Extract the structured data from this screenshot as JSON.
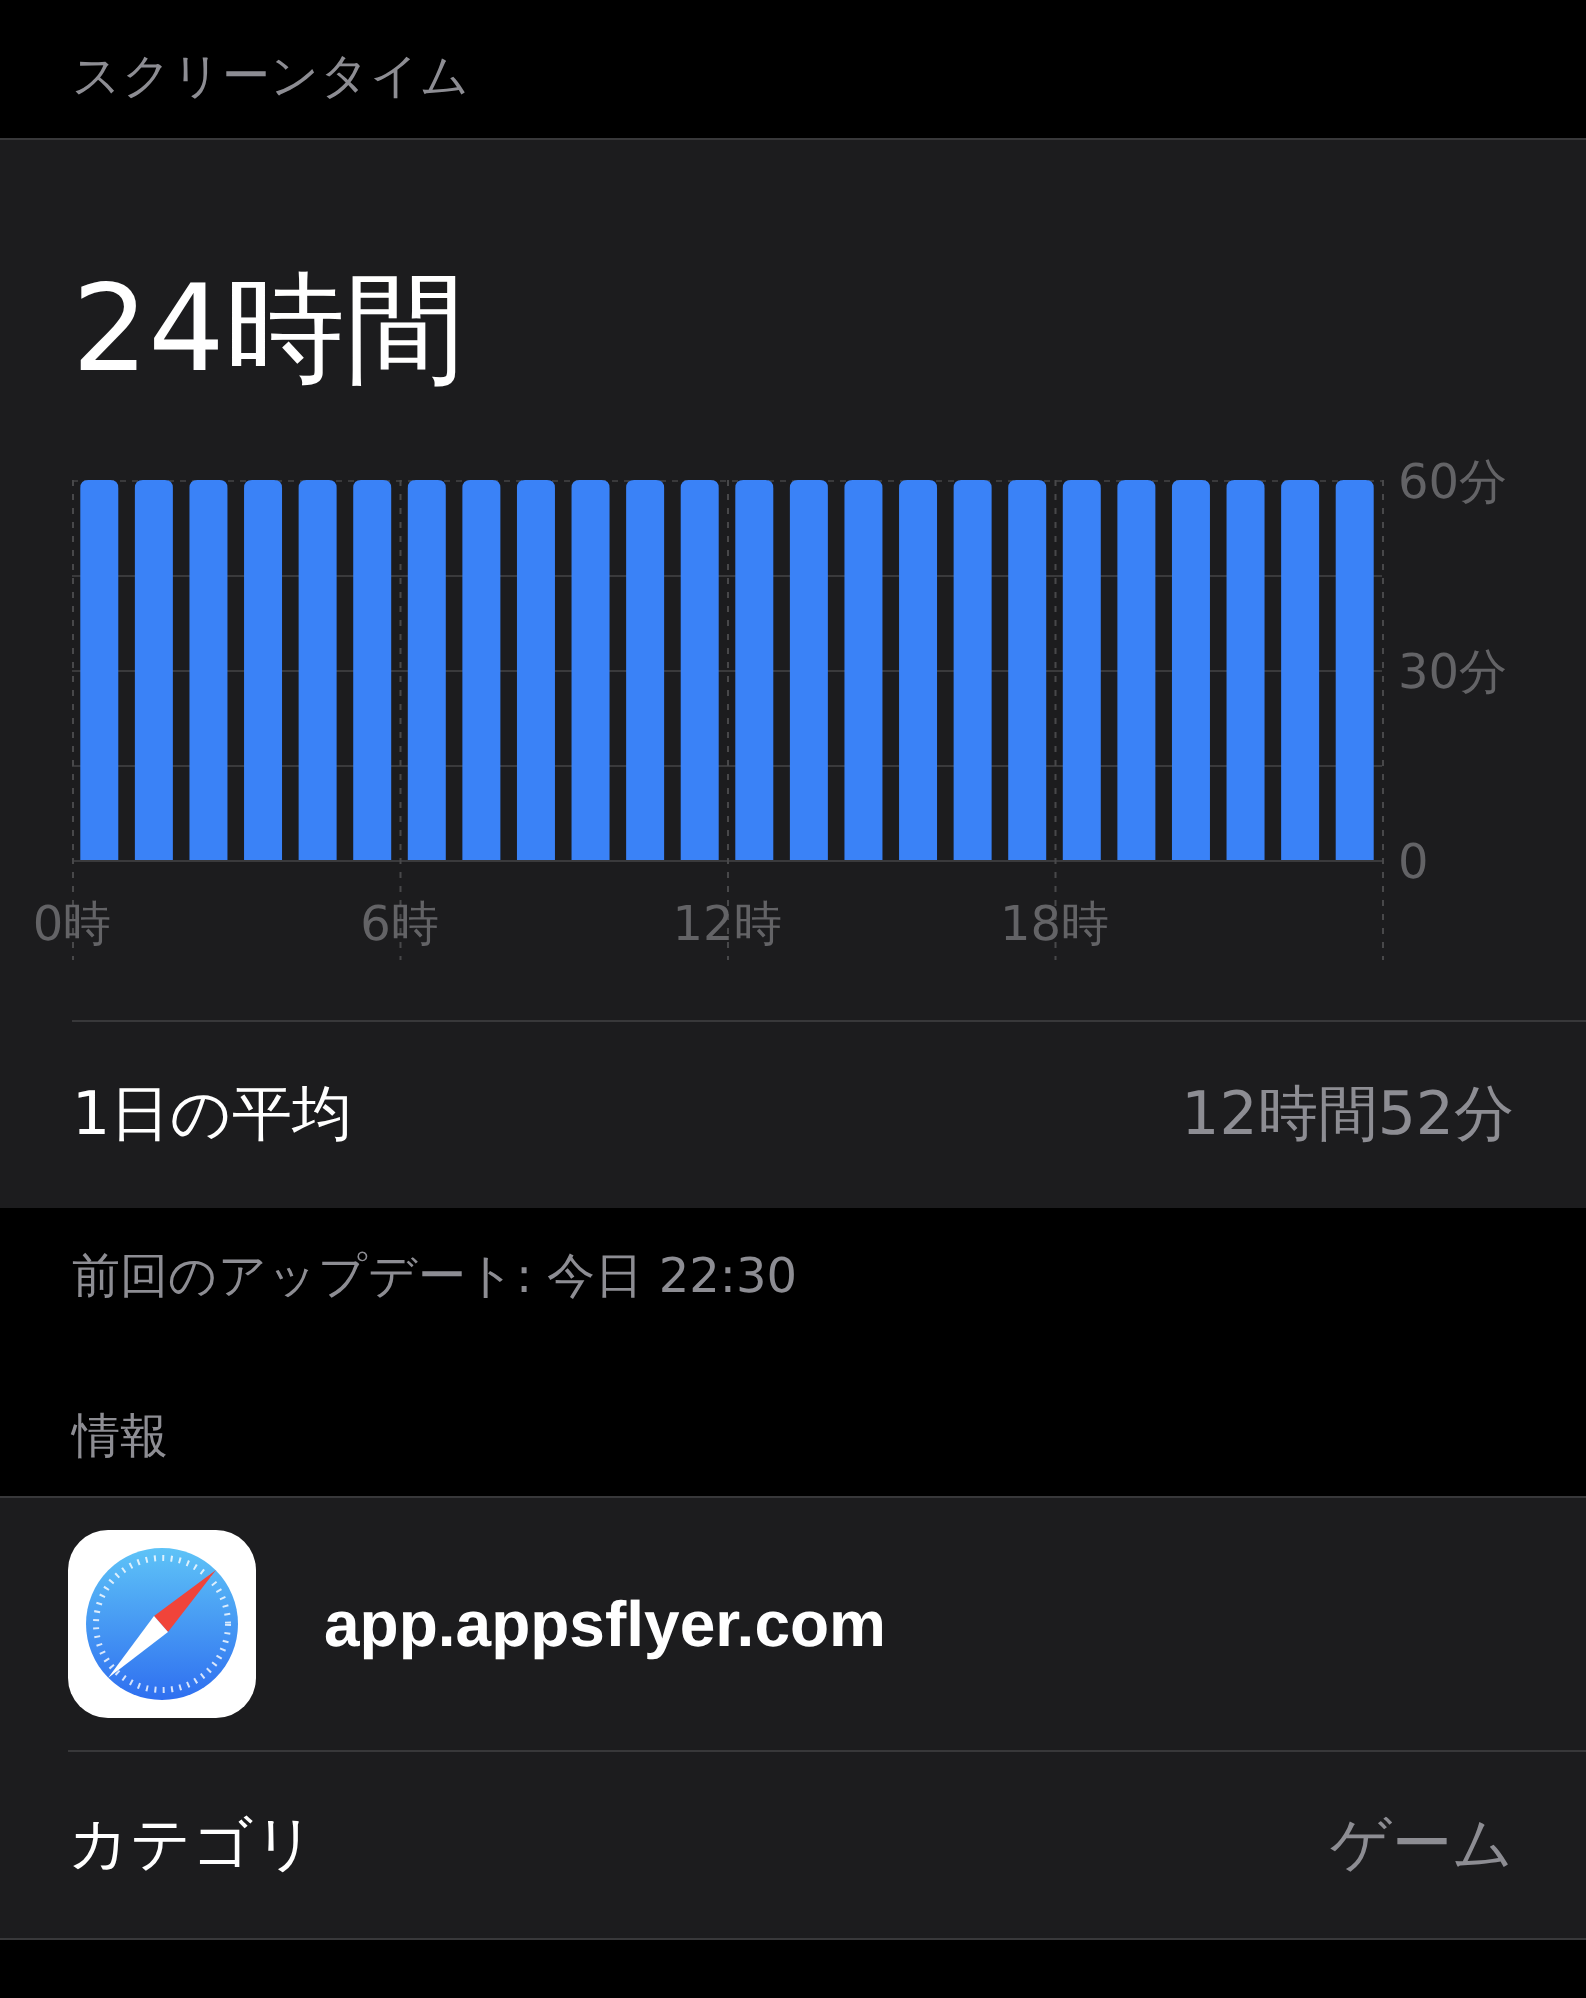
{
  "header": "スクリーンタイム",
  "summary": {
    "total": "24時間",
    "chart_data": {
      "type": "bar",
      "x": [
        0.5,
        1.5,
        2.5,
        3.5,
        4.5,
        5.5,
        6.5,
        7.5,
        8.5,
        9.5,
        10.5,
        11.5,
        12.5,
        13.5,
        14.5,
        15.5,
        16.5,
        17.5,
        18.5,
        19.5,
        20.5,
        21.5,
        22.5,
        23.5
      ],
      "xlim": [
        0,
        24
      ],
      "grid": true,
      "series": [
        {
          "color": "#3a82f7",
          "values": [
            60,
            60,
            60,
            60,
            60,
            60,
            60,
            60,
            60,
            60,
            60,
            60,
            60,
            60,
            60,
            60,
            60,
            60,
            60,
            60,
            60,
            60,
            60,
            60
          ]
        }
      ],
      "ylim": [
        0,
        60
      ],
      "yticks": [
        {
          "value": 0,
          "label": "0"
        },
        {
          "value": 30,
          "label": "30分"
        },
        {
          "value": 60,
          "label": "60分"
        }
      ],
      "xticks": [
        {
          "value": 0,
          "label": "0時"
        },
        {
          "value": 6,
          "label": "6時"
        },
        {
          "value": 12,
          "label": "12時"
        },
        {
          "value": 18,
          "label": "18時"
        }
      ]
    },
    "average": {
      "label": "1日の平均",
      "value": "12時間52分"
    }
  },
  "updated": "前回のアップデート: 今日 22:30",
  "info": {
    "heading": "情報",
    "app": "app.appsflyer.com",
    "category": {
      "label": "カテゴリ",
      "value": "ゲーム"
    }
  }
}
